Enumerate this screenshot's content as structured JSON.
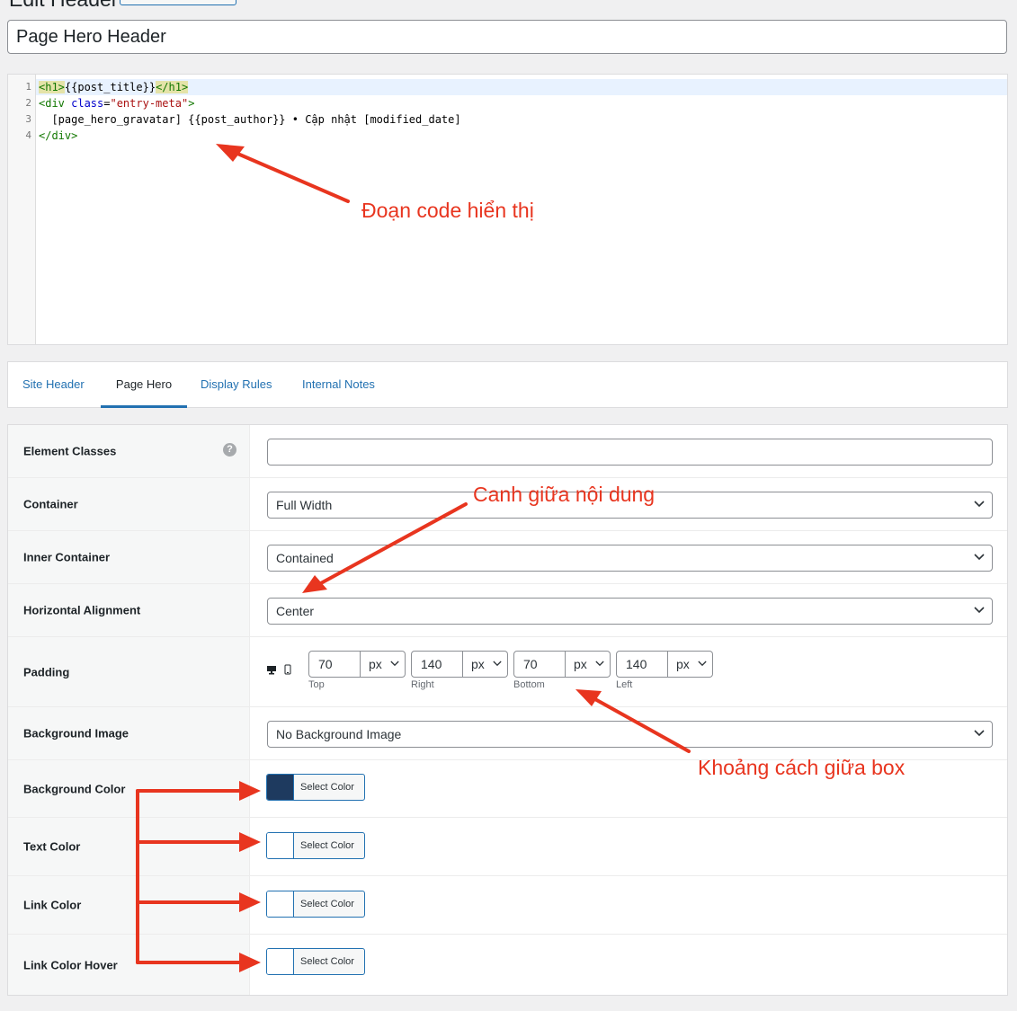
{
  "page": {
    "heading": "Edit Header",
    "title_value": "Page Hero Header"
  },
  "code_editor": {
    "line_numbers": [
      "1",
      "2",
      "3",
      "4"
    ],
    "line1": {
      "open_tag": "<h1>",
      "content": "{{post_title}}",
      "close_tag": "</h1>"
    },
    "line2": {
      "tag_start": "<div ",
      "attr": "class",
      "eq": "=",
      "value": "\"entry-meta\"",
      "tag_end": ">"
    },
    "line3": "  [page_hero_gravatar] {{post_author}} • Cập nhật [modified_date]",
    "line4": "</div>"
  },
  "tabs": [
    {
      "label": "Site Header"
    },
    {
      "label": "Page Hero"
    },
    {
      "label": "Display Rules"
    },
    {
      "label": "Internal Notes"
    }
  ],
  "active_tab": "Page Hero",
  "settings": {
    "element_classes": {
      "label": "Element Classes",
      "value": ""
    },
    "container": {
      "label": "Container",
      "value": "Full Width"
    },
    "inner_container": {
      "label": "Inner Container",
      "value": "Contained"
    },
    "horizontal_alignment": {
      "label": "Horizontal Alignment",
      "value": "Center"
    },
    "padding": {
      "label": "Padding",
      "top": {
        "value": "70",
        "unit": "px",
        "label": "Top"
      },
      "right": {
        "value": "140",
        "unit": "px",
        "label": "Right"
      },
      "bottom": {
        "value": "70",
        "unit": "px",
        "label": "Bottom"
      },
      "left": {
        "value": "140",
        "unit": "px",
        "label": "Left"
      }
    },
    "background_image": {
      "label": "Background Image",
      "value": "No Background Image"
    },
    "background_color": {
      "label": "Background Color",
      "button_label": "Select Color",
      "swatch_color": "#1e3a5f"
    },
    "text_color": {
      "label": "Text Color",
      "button_label": "Select Color",
      "swatch_color": "#ffffff"
    },
    "link_color": {
      "label": "Link Color",
      "button_label": "Select Color",
      "swatch_color": "#ffffff"
    },
    "link_color_hover": {
      "label": "Link Color Hover",
      "button_label": "Select Color",
      "swatch_color": "#ffffff"
    }
  },
  "annotations": {
    "code_note": "Đoạn code hiển thị",
    "align_note": "Canh giữa nội dung",
    "padding_note": "Khoảng cách giữa box"
  },
  "colors": {
    "accent": "#2271b1",
    "annotation": "#e8351f"
  }
}
